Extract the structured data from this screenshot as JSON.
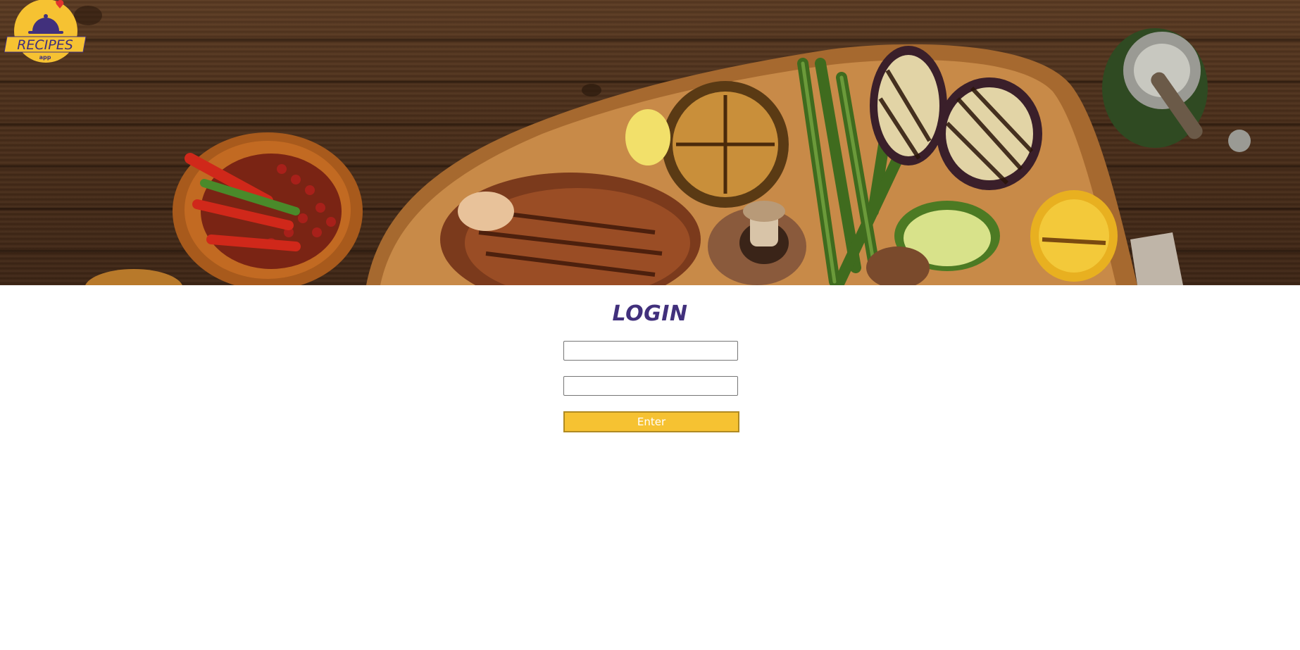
{
  "app": {
    "logo_text": "RECIPES",
    "logo_subtext": "app"
  },
  "colors": {
    "brand_purple": "#41307c",
    "brand_yellow": "#f6c232",
    "wood": "#4a2e1a"
  },
  "login": {
    "title": "LOGIN",
    "email_placeholder": "",
    "password_placeholder": "",
    "submit_label": "Enter"
  }
}
